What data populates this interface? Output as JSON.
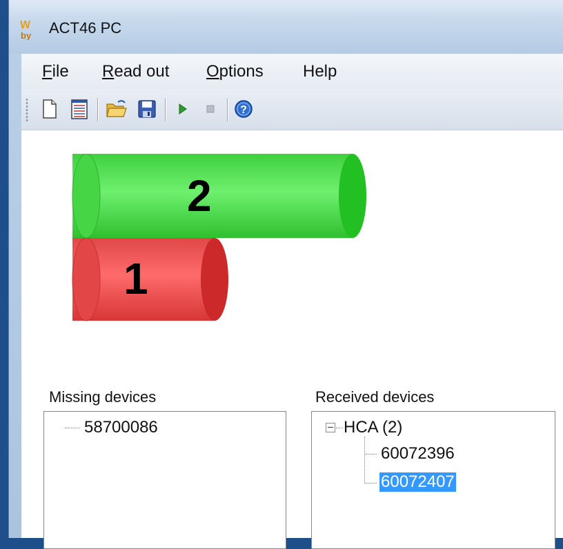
{
  "window": {
    "title": "ACT46 PC"
  },
  "menu": {
    "items": [
      {
        "label": "File",
        "accel": "F",
        "rest": "ile"
      },
      {
        "label": "Read out",
        "accel": "R",
        "rest": "ead out"
      },
      {
        "label": "Options",
        "accel": "O",
        "rest": "ptions"
      },
      {
        "label": "Help",
        "accel": "",
        "rest": "Help"
      }
    ]
  },
  "toolbar": {
    "buttons": [
      "new-document-icon",
      "list-view-icon",
      "open-folder-icon",
      "save-icon",
      "play-icon",
      "stop-icon",
      "help-icon"
    ]
  },
  "cylinders": [
    {
      "label": "2",
      "color": "#22cc22"
    },
    {
      "label": "1",
      "color": "#e03030"
    }
  ],
  "missing_devices": {
    "label": "Missing devices",
    "items": [
      "58700086"
    ]
  },
  "received_devices": {
    "label": "Received devices",
    "group": "HCA (2)",
    "items": [
      "60072396",
      "60072407"
    ],
    "selected": "60072407"
  },
  "colors": {
    "selection": "#3399ff",
    "green": "#22cc22",
    "red": "#e03030"
  }
}
